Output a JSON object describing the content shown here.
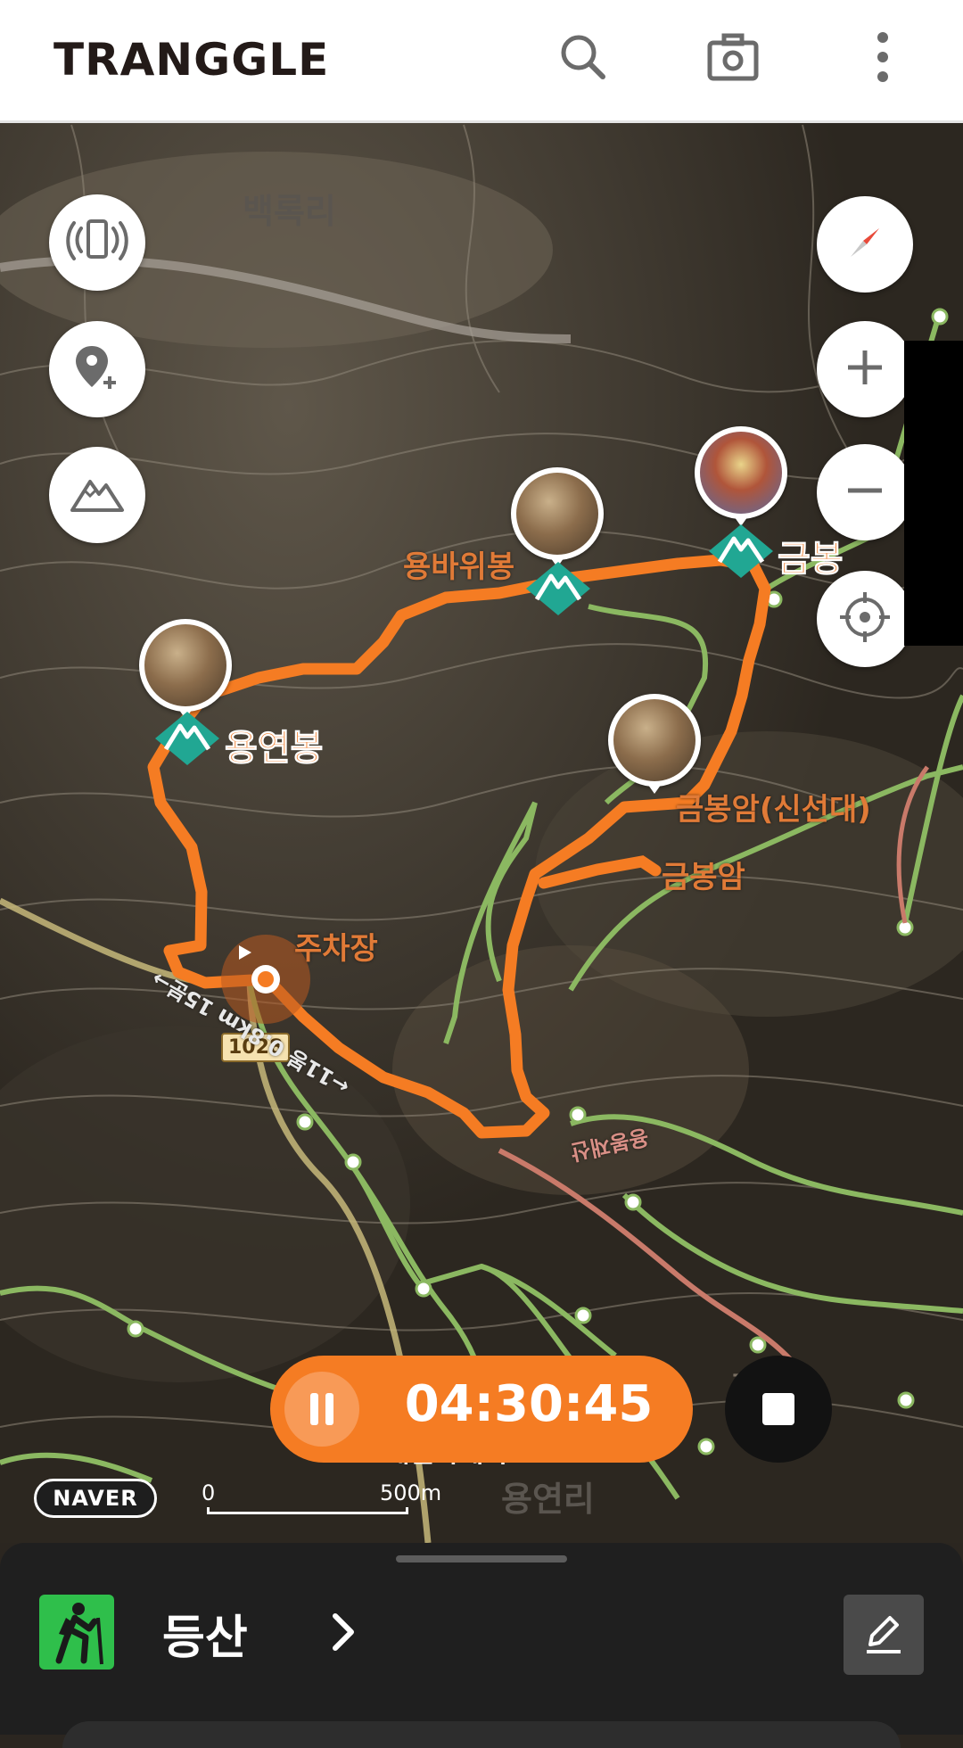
{
  "header": {
    "logo": "TRANGGLE",
    "icons": [
      "search-icon",
      "camera-icon",
      "more-vertical-icon"
    ]
  },
  "map": {
    "area_labels": {
      "baekrok_ri": "백록리",
      "yongyeon_ri": "용연리"
    },
    "peaks": {
      "yongyeonbong": "용연봉",
      "yongbawibong": "용바위봉",
      "geumbong": "금봉"
    },
    "places": {
      "geumbongam_sinseondae": "금봉암(신선대)",
      "geumbongam": "금봉암",
      "parking": "주차장",
      "partial_place": "가정",
      "partial_bottom": "대원사계곡"
    },
    "road_number": "1028",
    "trail_distance": "←11봉 0.8km 15분→",
    "trail_name": "용봉재산",
    "controls_left": [
      "beacon-icon",
      "add-location-icon",
      "mountain-icon"
    ],
    "controls_right": [
      "compass-icon",
      "zoom-in-icon",
      "zoom-out-icon",
      "my-location-icon"
    ],
    "naver_badge": "NAVER",
    "scale": {
      "start": "0",
      "end": "500m"
    },
    "colors": {
      "track": "#f57c23",
      "trail_green": "#8bb861",
      "peak_marker": "#21a793"
    }
  },
  "recording": {
    "elapsed": "04:30:45",
    "pause_icon": "pause-icon",
    "stop_icon": "stop-icon"
  },
  "bottom_sheet": {
    "activity_label": "등산",
    "activity_icon": "hiker-icon",
    "chevron_icon": "chevron-right-icon",
    "edit_icon": "edit-pencil-icon"
  }
}
